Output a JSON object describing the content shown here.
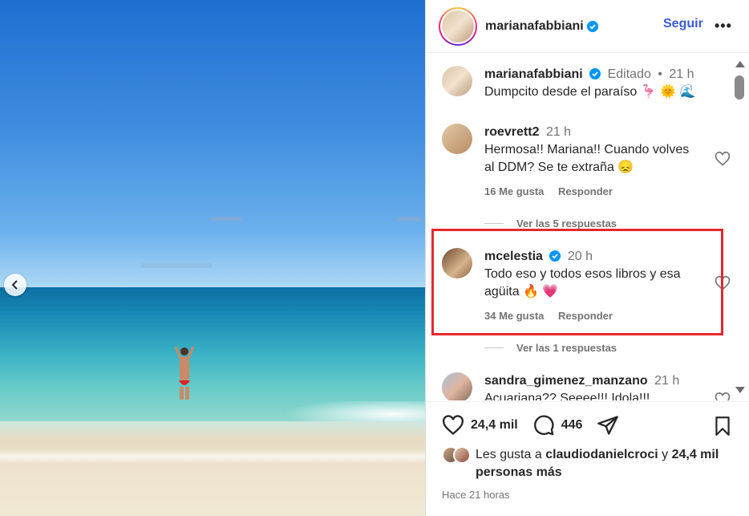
{
  "post": {
    "username": "marianafabbiani",
    "follow_label": "Seguir",
    "more_label": "•••"
  },
  "caption": {
    "username": "marianafabbiani",
    "edited": "Editado",
    "dot": "•",
    "time": "21 h",
    "text": "Dumpcito desde el paraíso 🦩 🌞 🌊"
  },
  "comments": [
    {
      "username": "roevrett2",
      "time": "21 h",
      "text": "Hermosa!! Mariana!! Cuando volves al DDM? Se te extraña 😞",
      "likes": "16 Me gusta",
      "reply": "Responder",
      "view_replies": "Ver las 5 respuestas"
    },
    {
      "username": "mcelestia",
      "time": "20 h",
      "text": "Todo eso y todos esos libros y esa agüita 🔥 💗",
      "likes": "34 Me gusta",
      "reply": "Responder",
      "view_replies": "Ver las 1 respuestas"
    },
    {
      "username": "sandra_gimenez_manzano",
      "time": "21 h",
      "text": "Acuariana?? Seeee!!! Idola!!!"
    }
  ],
  "actions": {
    "likes_count": "24,4 mil",
    "comments_count": "446"
  },
  "liked_by": {
    "prefix": "Les gusta a",
    "user": "claudiodanielcroci",
    "connector": "y",
    "others": "24,4 mil personas más"
  },
  "posted": "Hace 21 horas",
  "colors": {
    "accent": "#3b5bd6",
    "verified": "#0095f6",
    "highlight": "#e5282f"
  }
}
